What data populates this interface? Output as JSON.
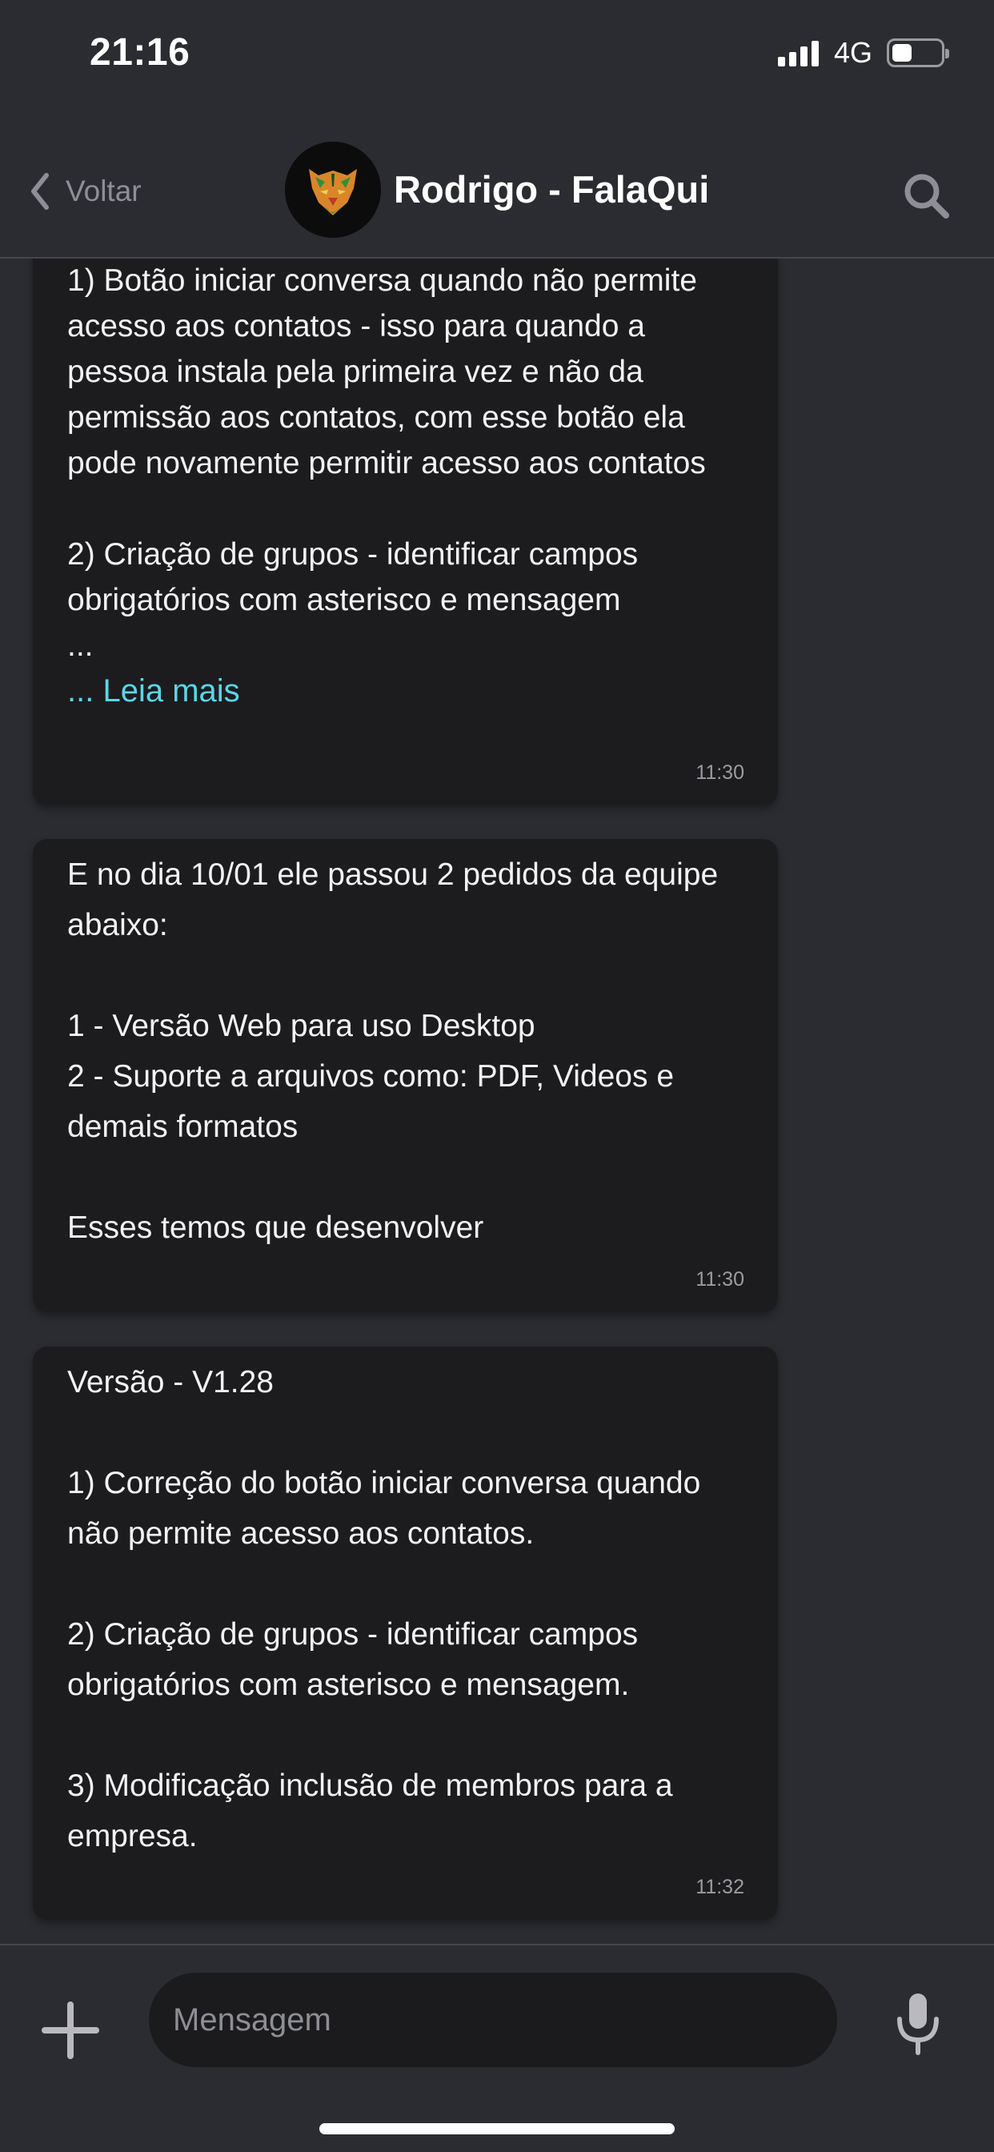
{
  "status_bar": {
    "time": "21:16",
    "network": "4G",
    "battery_level": 0.35,
    "icons": [
      "signal-icon",
      "battery-icon"
    ]
  },
  "header": {
    "back_label": "Voltar",
    "contact_name": "Rodrigo - FalaQui",
    "icons": [
      "chevron-left-icon",
      "avatar",
      "search-icon"
    ]
  },
  "messages": [
    {
      "text": "1) Botão iniciar conversa quando não permite acesso aos contatos - isso para quando a pessoa instala pela primeira vez e não da permissão aos contatos, com esse botão ela pode novamente permitir acesso aos contatos\n\n2) Criação de grupos - identificar campos obrigatórios com asterisco e mensagem\n...",
      "read_more": "... Leia mais",
      "time": "11:30"
    },
    {
      "text": "E no dia 10/01 ele passou 2 pedidos da equipe abaixo:\n\n1 - Versão Web para uso Desktop\n2 - Suporte a arquivos como: PDF, Videos e demais formatos\n\nEsses temos que desenvolver",
      "time": "11:30"
    },
    {
      "text": "Versão - V1.28\n\n1) Correção do botão iniciar conversa quando não permite acesso aos contatos.\n\n2) Criação de grupos - identificar campos obrigatórios com asterisco e mensagem.\n\n3) Modificação inclusão de membros para a empresa.",
      "time": "11:32"
    }
  ],
  "composer": {
    "placeholder": "Mensagem",
    "value": "",
    "icons": [
      "plus-icon",
      "microphone-icon"
    ]
  },
  "colors": {
    "background": "#2b2c31",
    "bubble": "#1c1c1e",
    "link": "#5bd6e8",
    "muted": "#8d8e96"
  }
}
